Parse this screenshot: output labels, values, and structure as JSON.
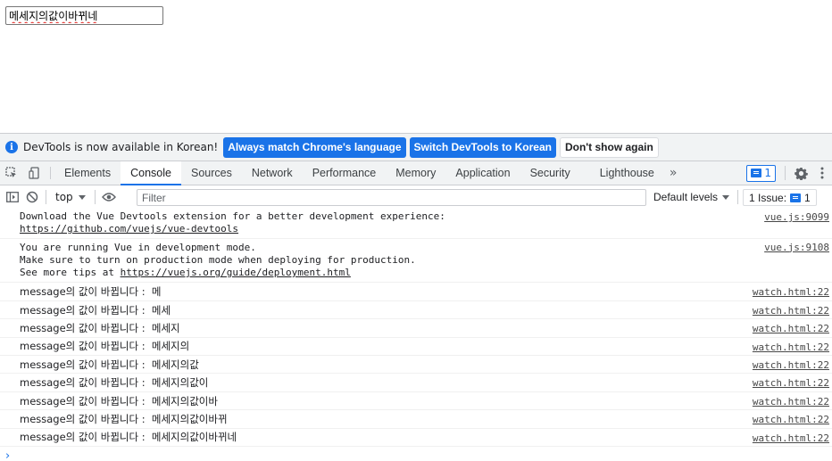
{
  "page": {
    "input_value": "메세지의값이바뀌네"
  },
  "infobar": {
    "text": "DevTools is now available in Korean!",
    "btn_match": "Always match Chrome's language",
    "btn_switch": "Switch DevTools to Korean",
    "btn_dismiss": "Don't show again"
  },
  "tabs": {
    "elements": "Elements",
    "console": "Console",
    "sources": "Sources",
    "network": "Network",
    "performance": "Performance",
    "memory": "Memory",
    "application": "Application",
    "security": "Security",
    "lighthouse": "Lighthouse",
    "more": "»",
    "issue_count": "1"
  },
  "toolbar": {
    "context": "top",
    "filter_placeholder": "Filter",
    "levels": "Default levels",
    "issues_label": "1 Issue:",
    "issues_count": "1"
  },
  "messages": {
    "m1_line1": "Download the Vue Devtools extension for a better development experience:",
    "m1_link": "https://github.com/vuejs/vue-devtools",
    "m1_src": "vue.js:9099",
    "m2_line1": "You are running Vue in development mode.",
    "m2_line2": "Make sure to turn on production mode when deploying for production.",
    "m2_line3_prefix": "See more tips at ",
    "m2_link": "https://vuejs.org/guide/deployment.html",
    "m2_src": "vue.js:9108"
  },
  "logs": [
    {
      "text": "message의 값이 바뀝니다 :  메",
      "src": "watch.html:22"
    },
    {
      "text": "message의 값이 바뀝니다 :  메세",
      "src": "watch.html:22"
    },
    {
      "text": "message의 값이 바뀝니다 :  메세지",
      "src": "watch.html:22"
    },
    {
      "text": "message의 값이 바뀝니다 :  메세지의",
      "src": "watch.html:22"
    },
    {
      "text": "message의 값이 바뀝니다 :  메세지의값",
      "src": "watch.html:22"
    },
    {
      "text": "message의 값이 바뀝니다 :  메세지의값이",
      "src": "watch.html:22"
    },
    {
      "text": "message의 값이 바뀝니다 :  메세지의값이바",
      "src": "watch.html:22"
    },
    {
      "text": "message의 값이 바뀝니다 :  메세지의값이바뀌",
      "src": "watch.html:22"
    },
    {
      "text": "message의 값이 바뀝니다 :  메세지의값이바뀌네",
      "src": "watch.html:22"
    }
  ],
  "prompt_glyph": "›"
}
